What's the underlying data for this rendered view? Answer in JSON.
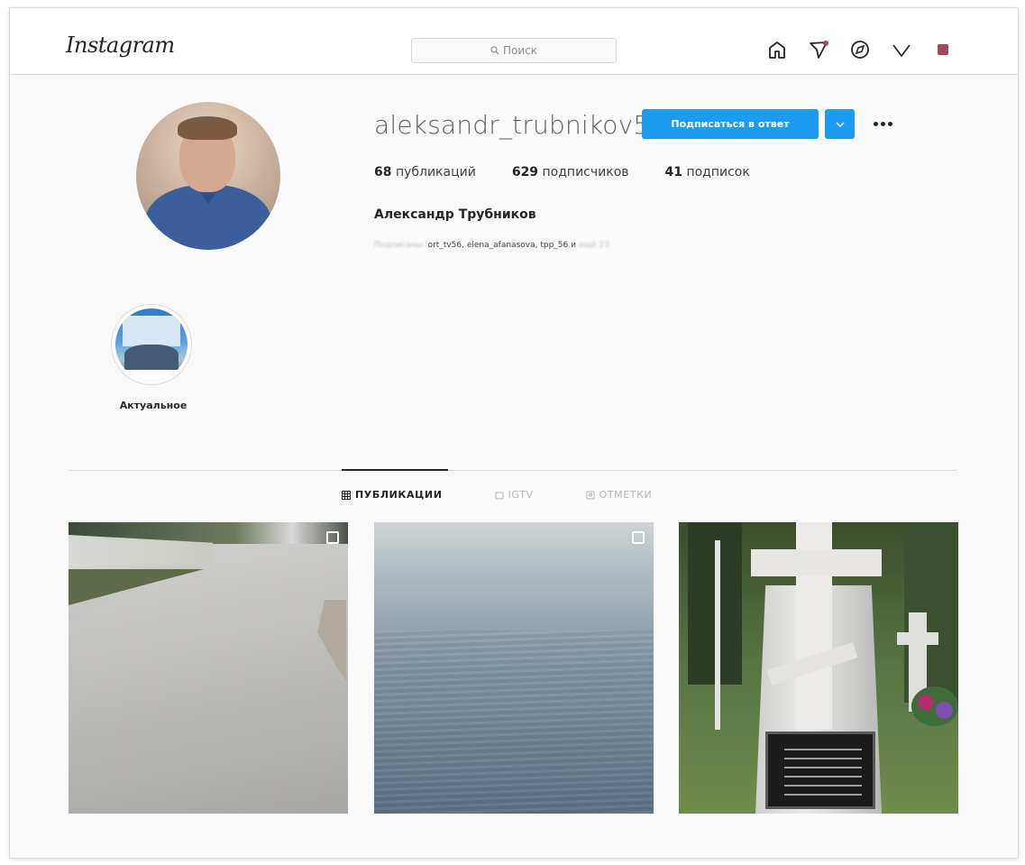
{
  "nav": {
    "logo": "Instagram",
    "search_placeholder": "Поиск",
    "icons": [
      "home-icon",
      "direct-icon",
      "explore-icon",
      "activity-icon",
      "profile-icon"
    ]
  },
  "profile": {
    "username": "aleksandr_trubnikov56",
    "follow_back_label": "Подписаться в ответ",
    "stats": {
      "posts_count": "68",
      "posts_label": "публикаций",
      "followers_count": "629",
      "followers_label": "подписчиков",
      "following_count": "41",
      "following_label": "подписок"
    },
    "full_name": "Александр Трубников",
    "followed_by": {
      "prefix": "Подписаны:",
      "names": "ort_tv56, elena_afanasova, tpp_56",
      "connector": " и ",
      "suffix": "ещё 23"
    }
  },
  "highlights": [
    {
      "label": "Актуальное"
    }
  ],
  "tabs": [
    {
      "label": "ПУБЛИКАЦИИ",
      "active": true,
      "icon": "grid-icon"
    },
    {
      "label": "IGTV",
      "active": false,
      "icon": "igtv-icon"
    },
    {
      "label": "ОТМЕТКИ",
      "active": false,
      "icon": "tag-icon"
    }
  ],
  "colors": {
    "accent": "#1b9cf0",
    "text": "#262626",
    "border": "#dbdbdb",
    "background": "#fafafa"
  }
}
